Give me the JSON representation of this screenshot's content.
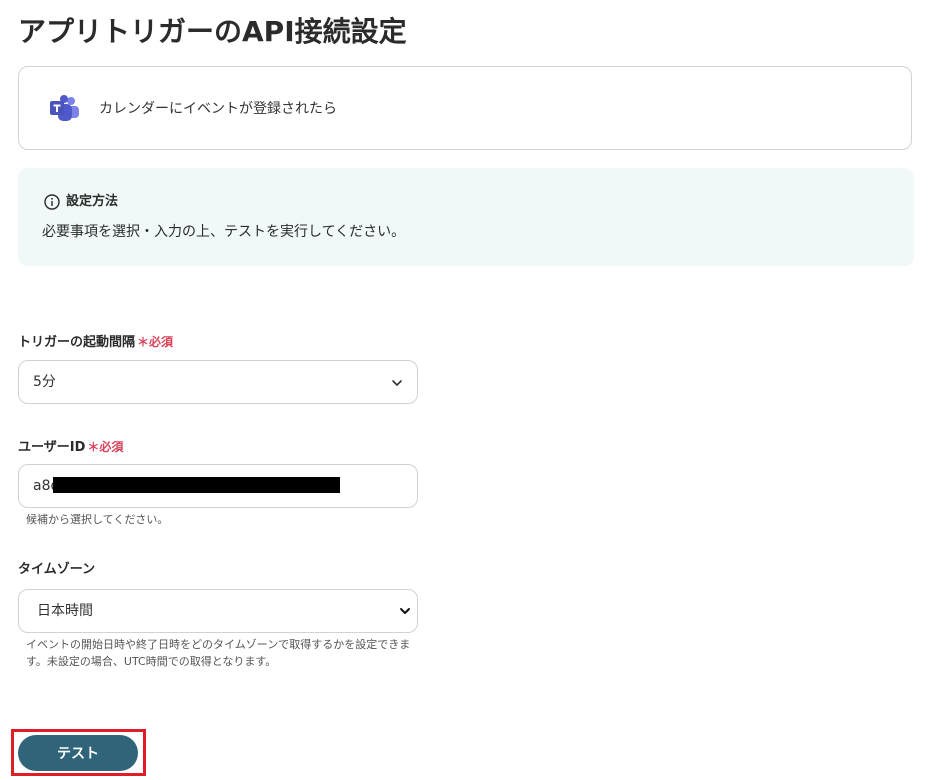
{
  "page_title": "アプリトリガーのAPI接続設定",
  "app_card": {
    "icon": "microsoft-teams-icon",
    "label": "カレンダーにイベントが登録されたら"
  },
  "info_box": {
    "icon": "info-icon",
    "title": "設定方法",
    "text": "必要事項を選択・入力の上、テストを実行してください。"
  },
  "fields": {
    "interval": {
      "label": "トリガーの起動間隔",
      "required_text": "＊必須",
      "value": "5分"
    },
    "user_id": {
      "label": "ユーザーID",
      "required_text": "＊必須",
      "value_visible": "a8d",
      "hint": "候補から選択してください。"
    },
    "timezone": {
      "label": "タイムゾーン",
      "value": "日本時間",
      "hint_line1": "イベントの開始日時や終了日時をどのタイムゾーンで取得するかを設定できま",
      "hint_line2": "す。未設定の場合、UTC時間での取得となります。"
    }
  },
  "test_button": {
    "label": "テスト"
  },
  "colors": {
    "required": "#d9445a",
    "button": "#2f6479",
    "info_bg": "#f1f9f8",
    "highlight": "#e01c26"
  }
}
